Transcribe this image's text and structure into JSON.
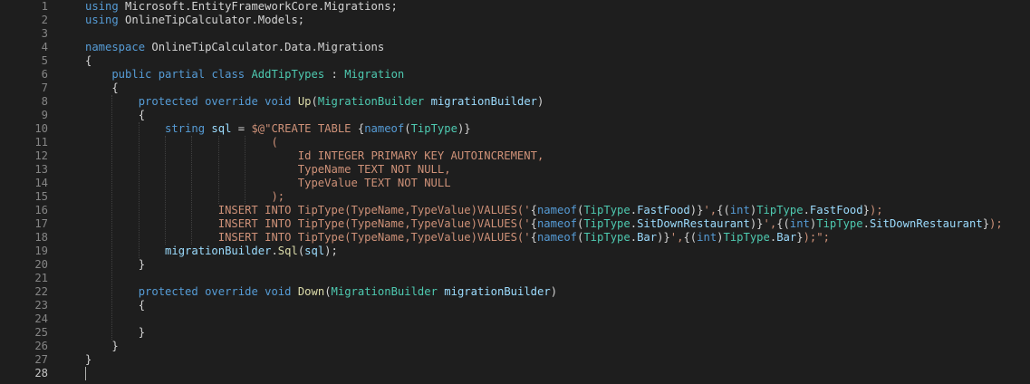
{
  "editor": {
    "colors": {
      "background": "#1e1e1e",
      "plain": "#d4d4d4",
      "keyword": "#569cd6",
      "type": "#4ec9b0",
      "function": "#dcdcaa",
      "variable": "#9cdcfe",
      "string": "#ce9178",
      "line_number": "#858585"
    },
    "active_line": 28,
    "lines": [
      {
        "n": "1",
        "indent": 0,
        "tokens": [
          {
            "t": "using",
            "c": "k"
          },
          {
            "t": " ",
            "c": "p"
          },
          {
            "t": "Microsoft.EntityFrameworkCore.Migrations;",
            "c": "p"
          }
        ]
      },
      {
        "n": "2",
        "indent": 0,
        "tokens": [
          {
            "t": "using",
            "c": "k"
          },
          {
            "t": " ",
            "c": "p"
          },
          {
            "t": "OnlineTipCalculator.Models;",
            "c": "p"
          }
        ]
      },
      {
        "n": "3",
        "indent": 0,
        "tokens": []
      },
      {
        "n": "4",
        "indent": 0,
        "tokens": [
          {
            "t": "namespace",
            "c": "k"
          },
          {
            "t": " OnlineTipCalculator.Data.Migrations",
            "c": "p"
          }
        ]
      },
      {
        "n": "5",
        "indent": 0,
        "tokens": [
          {
            "t": "{",
            "c": "p"
          }
        ]
      },
      {
        "n": "6",
        "indent": 4,
        "tokens": [
          {
            "t": "public",
            "c": "k"
          },
          {
            "t": " ",
            "c": "p"
          },
          {
            "t": "partial",
            "c": "k"
          },
          {
            "t": " ",
            "c": "p"
          },
          {
            "t": "class",
            "c": "k"
          },
          {
            "t": " ",
            "c": "p"
          },
          {
            "t": "AddTipTypes",
            "c": "t"
          },
          {
            "t": " : ",
            "c": "p"
          },
          {
            "t": "Migration",
            "c": "t"
          }
        ]
      },
      {
        "n": "7",
        "indent": 4,
        "tokens": [
          {
            "t": "{",
            "c": "p"
          }
        ]
      },
      {
        "n": "8",
        "indent": 8,
        "tokens": [
          {
            "t": "protected",
            "c": "k"
          },
          {
            "t": " ",
            "c": "p"
          },
          {
            "t": "override",
            "c": "k"
          },
          {
            "t": " ",
            "c": "p"
          },
          {
            "t": "void",
            "c": "k"
          },
          {
            "t": " ",
            "c": "p"
          },
          {
            "t": "Up",
            "c": "f"
          },
          {
            "t": "(",
            "c": "p"
          },
          {
            "t": "MigrationBuilder",
            "c": "t"
          },
          {
            "t": " ",
            "c": "p"
          },
          {
            "t": "migrationBuilder",
            "c": "v"
          },
          {
            "t": ")",
            "c": "p"
          }
        ]
      },
      {
        "n": "9",
        "indent": 8,
        "tokens": [
          {
            "t": "{",
            "c": "p"
          }
        ]
      },
      {
        "n": "10",
        "indent": 12,
        "tokens": [
          {
            "t": "string",
            "c": "k"
          },
          {
            "t": " ",
            "c": "p"
          },
          {
            "t": "sql",
            "c": "v"
          },
          {
            "t": " = ",
            "c": "p"
          },
          {
            "t": "$@\"CREATE TABLE ",
            "c": "s"
          },
          {
            "t": "{",
            "c": "p"
          },
          {
            "t": "nameof",
            "c": "k"
          },
          {
            "t": "(",
            "c": "p"
          },
          {
            "t": "TipType",
            "c": "t"
          },
          {
            "t": ")}",
            "c": "p"
          }
        ]
      },
      {
        "n": "11",
        "indent": 28,
        "tokens": [
          {
            "t": "(",
            "c": "s"
          }
        ]
      },
      {
        "n": "12",
        "indent": 32,
        "tokens": [
          {
            "t": "Id INTEGER PRIMARY KEY AUTOINCREMENT,",
            "c": "s"
          }
        ]
      },
      {
        "n": "13",
        "indent": 32,
        "tokens": [
          {
            "t": "TypeName TEXT NOT NULL,",
            "c": "s"
          }
        ]
      },
      {
        "n": "14",
        "indent": 32,
        "tokens": [
          {
            "t": "TypeValue TEXT NOT NULL",
            "c": "s"
          }
        ]
      },
      {
        "n": "15",
        "indent": 28,
        "tokens": [
          {
            "t": ");",
            "c": "s"
          }
        ]
      },
      {
        "n": "16",
        "indent": 20,
        "tokens": [
          {
            "t": "INSERT INTO TipType(TypeName,TypeValue)VALUES('",
            "c": "s"
          },
          {
            "t": "{",
            "c": "p"
          },
          {
            "t": "nameof",
            "c": "k"
          },
          {
            "t": "(",
            "c": "p"
          },
          {
            "t": "TipType",
            "c": "t"
          },
          {
            "t": ".",
            "c": "p"
          },
          {
            "t": "FastFood",
            "c": "v"
          },
          {
            "t": ")}",
            "c": "p"
          },
          {
            "t": "',",
            "c": "s"
          },
          {
            "t": "{(",
            "c": "p"
          },
          {
            "t": "int",
            "c": "k"
          },
          {
            "t": ")",
            "c": "p"
          },
          {
            "t": "TipType",
            "c": "t"
          },
          {
            "t": ".",
            "c": "p"
          },
          {
            "t": "FastFood",
            "c": "v"
          },
          {
            "t": "}",
            "c": "p"
          },
          {
            "t": ");",
            "c": "s"
          }
        ]
      },
      {
        "n": "17",
        "indent": 20,
        "tokens": [
          {
            "t": "INSERT INTO TipType(TypeName,TypeValue)VALUES('",
            "c": "s"
          },
          {
            "t": "{",
            "c": "p"
          },
          {
            "t": "nameof",
            "c": "k"
          },
          {
            "t": "(",
            "c": "p"
          },
          {
            "t": "TipType",
            "c": "t"
          },
          {
            "t": ".",
            "c": "p"
          },
          {
            "t": "SitDownRestaurant",
            "c": "v"
          },
          {
            "t": ")}",
            "c": "p"
          },
          {
            "t": "',",
            "c": "s"
          },
          {
            "t": "{(",
            "c": "p"
          },
          {
            "t": "int",
            "c": "k"
          },
          {
            "t": ")",
            "c": "p"
          },
          {
            "t": "TipType",
            "c": "t"
          },
          {
            "t": ".",
            "c": "p"
          },
          {
            "t": "SitDownRestaurant",
            "c": "v"
          },
          {
            "t": "}",
            "c": "p"
          },
          {
            "t": ");",
            "c": "s"
          }
        ]
      },
      {
        "n": "18",
        "indent": 20,
        "tokens": [
          {
            "t": "INSERT INTO TipType(TypeName,TypeValue)VALUES('",
            "c": "s"
          },
          {
            "t": "{",
            "c": "p"
          },
          {
            "t": "nameof",
            "c": "k"
          },
          {
            "t": "(",
            "c": "p"
          },
          {
            "t": "TipType",
            "c": "t"
          },
          {
            "t": ".",
            "c": "p"
          },
          {
            "t": "Bar",
            "c": "v"
          },
          {
            "t": ")}",
            "c": "p"
          },
          {
            "t": "',",
            "c": "s"
          },
          {
            "t": "{(",
            "c": "p"
          },
          {
            "t": "int",
            "c": "k"
          },
          {
            "t": ")",
            "c": "p"
          },
          {
            "t": "TipType",
            "c": "t"
          },
          {
            "t": ".",
            "c": "p"
          },
          {
            "t": "Bar",
            "c": "v"
          },
          {
            "t": "}",
            "c": "p"
          },
          {
            "t": ");\";",
            "c": "s"
          }
        ]
      },
      {
        "n": "19",
        "indent": 12,
        "tokens": [
          {
            "t": "migrationBuilder",
            "c": "v"
          },
          {
            "t": ".",
            "c": "p"
          },
          {
            "t": "Sql",
            "c": "f"
          },
          {
            "t": "(",
            "c": "p"
          },
          {
            "t": "sql",
            "c": "v"
          },
          {
            "t": ");",
            "c": "p"
          }
        ]
      },
      {
        "n": "20",
        "indent": 8,
        "tokens": [
          {
            "t": "}",
            "c": "p"
          }
        ]
      },
      {
        "n": "21",
        "indent": 0,
        "tokens": []
      },
      {
        "n": "22",
        "indent": 8,
        "tokens": [
          {
            "t": "protected",
            "c": "k"
          },
          {
            "t": " ",
            "c": "p"
          },
          {
            "t": "override",
            "c": "k"
          },
          {
            "t": " ",
            "c": "p"
          },
          {
            "t": "void",
            "c": "k"
          },
          {
            "t": " ",
            "c": "p"
          },
          {
            "t": "Down",
            "c": "f"
          },
          {
            "t": "(",
            "c": "p"
          },
          {
            "t": "MigrationBuilder",
            "c": "t"
          },
          {
            "t": " ",
            "c": "p"
          },
          {
            "t": "migrationBuilder",
            "c": "v"
          },
          {
            "t": ")",
            "c": "p"
          }
        ]
      },
      {
        "n": "23",
        "indent": 8,
        "tokens": [
          {
            "t": "{",
            "c": "p"
          }
        ]
      },
      {
        "n": "24",
        "indent": 0,
        "tokens": []
      },
      {
        "n": "25",
        "indent": 8,
        "tokens": [
          {
            "t": "}",
            "c": "p"
          }
        ]
      },
      {
        "n": "26",
        "indent": 4,
        "tokens": [
          {
            "t": "}",
            "c": "p"
          }
        ]
      },
      {
        "n": "27",
        "indent": 0,
        "tokens": [
          {
            "t": "}",
            "c": "p"
          }
        ]
      },
      {
        "n": "28",
        "indent": 0,
        "tokens": []
      }
    ]
  }
}
